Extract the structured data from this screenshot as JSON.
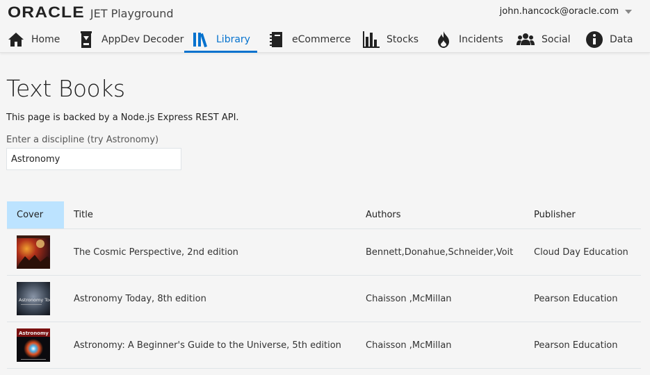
{
  "header": {
    "brand": "ORACLE",
    "app_name": "JET Playground",
    "user_email": "john.hancock@oracle.com"
  },
  "nav": {
    "tabs": [
      {
        "label": "Home",
        "icon": "home-icon"
      },
      {
        "label": "AppDev Decoder",
        "icon": "decoder-icon"
      },
      {
        "label": "Library",
        "icon": "library-icon",
        "active": true
      },
      {
        "label": "eCommerce",
        "icon": "notebook-icon"
      },
      {
        "label": "Stocks",
        "icon": "bar-chart-icon"
      },
      {
        "label": "Incidents",
        "icon": "fire-icon"
      },
      {
        "label": "Social",
        "icon": "people-icon"
      },
      {
        "label": "Data",
        "icon": "info-icon"
      }
    ]
  },
  "main": {
    "title": "Text Books",
    "description": "This page is backed by a Node.js Express REST API.",
    "input_label": "Enter a discipline (try Astronomy)",
    "input_value": "Astronomy"
  },
  "table": {
    "columns": [
      "Cover",
      "Title",
      "Authors",
      "Publisher"
    ],
    "rows": [
      {
        "title": "The Cosmic Perspective, 2nd edition",
        "authors": "Bennett,Donahue,Schneider,Voit",
        "publisher": "Cloud Day Education"
      },
      {
        "title": "Astronomy Today, 8th edition",
        "authors": "Chaisson ,McMillan",
        "publisher": "Pearson Education",
        "cover_text": "Astronomy Today"
      },
      {
        "title": "Astronomy: A Beginner's Guide to the Universe, 5th edition",
        "authors": "Chaisson ,McMillan",
        "publisher": "Pearson Education",
        "cover_text": "Astronomy"
      }
    ]
  },
  "colors": {
    "accent": "#0572ce",
    "sorted_header": "#bce3ff",
    "background": "#f5f5f5"
  }
}
